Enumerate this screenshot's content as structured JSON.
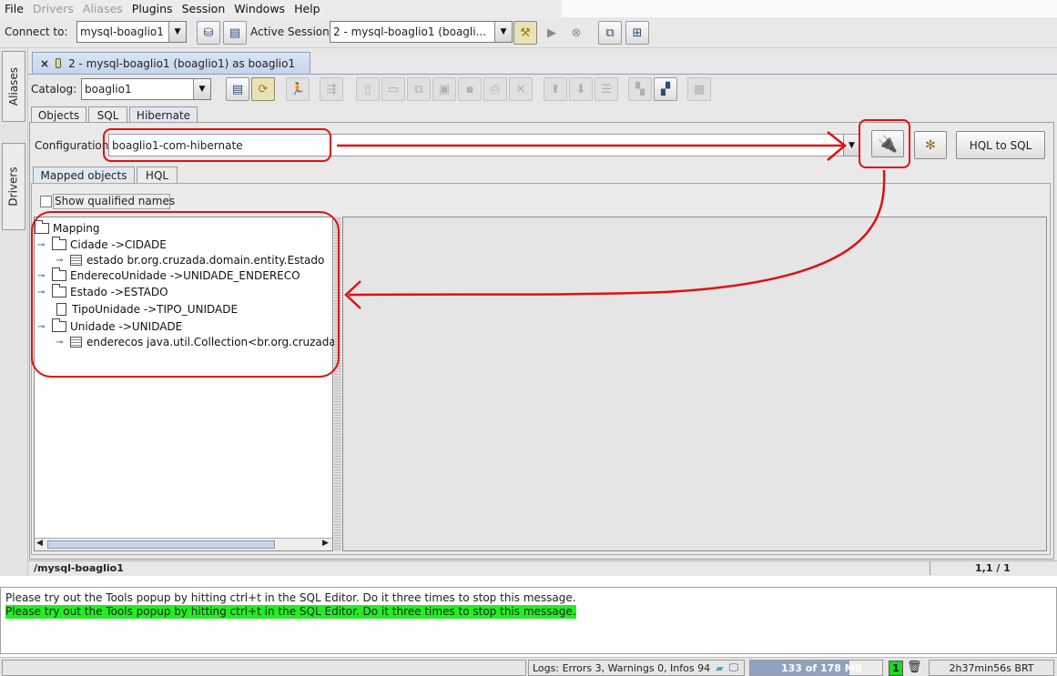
{
  "menubar": {
    "items": [
      {
        "label": "File",
        "enabled": true
      },
      {
        "label": "Drivers",
        "enabled": false
      },
      {
        "label": "Aliases",
        "enabled": false
      },
      {
        "label": "Plugins",
        "enabled": true
      },
      {
        "label": "Session",
        "enabled": true
      },
      {
        "label": "Windows",
        "enabled": true
      },
      {
        "label": "Help",
        "enabled": true
      }
    ]
  },
  "toolbar": {
    "connect_label": "Connect to:",
    "connect_value": "mysql-boaglio1",
    "active_session_label": "Active Session:",
    "active_session_value": "2 - mysql-boaglio1 (boagli..."
  },
  "sidebar": {
    "tabs": [
      "Aliases",
      "Drivers"
    ]
  },
  "session_tab": {
    "close": "×",
    "title": "2 - mysql-boaglio1 (boaglio1) as boaglio1"
  },
  "catalog": {
    "label": "Catalog:",
    "value": "boaglio1"
  },
  "subtabs": [
    "Objects",
    "SQL",
    "Hibernate"
  ],
  "hibernate": {
    "config_label": "Configuration",
    "config_value": "boaglio1-com-hibernate",
    "hql_to_sql": "HQL to SQL",
    "inner_tabs": [
      "Mapped objects",
      "HQL"
    ],
    "show_qualified": "Show qualified names",
    "tree": {
      "root": "Mapping",
      "nodes": [
        {
          "label": "Cidade ->CIDADE",
          "icon": "folder-icon",
          "children": [
            {
              "label": "estado br.org.cruzada.domain.entity.Estado",
              "icon": "table-icon"
            }
          ]
        },
        {
          "label": "EnderecoUnidade ->UNIDADE_ENDERECO",
          "icon": "folder-icon",
          "children": []
        },
        {
          "label": "Estado ->ESTADO",
          "icon": "folder-icon",
          "children": []
        },
        {
          "label": "TipoUnidade ->TIPO_UNIDADE",
          "icon": "document-icon",
          "children": []
        },
        {
          "label": "Unidade ->UNIDADE",
          "icon": "folder-icon",
          "children": [
            {
              "label": "enderecos java.util.Collection<br.org.cruzada.",
              "icon": "table-icon"
            }
          ]
        }
      ]
    }
  },
  "status": {
    "path": "/mysql-boaglio1",
    "position": "1,1 / 1"
  },
  "messages": [
    {
      "text": "Please try out the Tools popup by hitting ctrl+t in the SQL Editor. Do it three times to stop this message.",
      "highlight": false
    },
    {
      "text": "Please try out the Tools popup by hitting ctrl+t in the SQL Editor. Do it three times to stop this message.",
      "highlight": true
    }
  ],
  "bottom": {
    "logs": "Logs: Errors 3, Warnings 0, Infos 94",
    "memory": "133 of 178 MB",
    "memory_fraction": 0.75,
    "badge": "1",
    "time": "2h37min56s BRT"
  },
  "colors": {
    "annotation": "#e01010",
    "highlight": "#22ee22"
  }
}
